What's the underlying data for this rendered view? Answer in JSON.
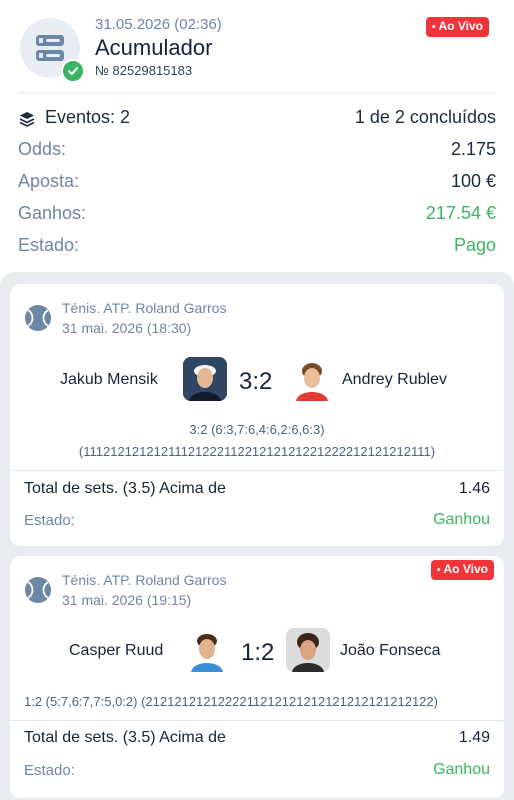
{
  "header": {
    "date": "31.05.2026 (02:36)",
    "title": "Acumulador",
    "number": "№ 82529815183",
    "live_label": "Ao Vivo"
  },
  "summary": {
    "events_label": "Eventos: 2",
    "events_value": "1 de 2 concluídos",
    "odds_label": "Odds:",
    "odds_value": "2.175",
    "stake_label": "Aposta:",
    "stake_value": "100 €",
    "winnings_label": "Ganhos:",
    "winnings_value": "217.54 €",
    "status_label": "Estado:",
    "status_value": "Pago"
  },
  "events": [
    {
      "league": "Ténis. ATP. Roland Garros",
      "date": "31 mai. 2026 (18:30)",
      "player1": "Jakub Mensik",
      "player2": "Andrey Rublev",
      "score": "3:2",
      "detail_line1": "3:2 (6:3,7:6,4:6,2:6,6:3)",
      "detail_line2": "(1112121212121112122211221212121221222212121212111)",
      "market": "Total de sets. (3.5) Acima de",
      "odds": "1.46",
      "status_label": "Estado:",
      "status_value": "Ganhou"
    },
    {
      "league": "Ténis. ATP. Roland Garros",
      "date": "31 mai. 2026 (19:15)",
      "player1": "Casper Ruud",
      "player2": "João Fonseca",
      "score": "1:2",
      "live_label": "Ao Vivo",
      "detail_line1": "1:2 (5:7,6:7,7:5,0:2) (2121212121222211212121212121212121212122)",
      "market": "Total de sets. (3.5) Acima de",
      "odds": "1.49",
      "status_label": "Estado:",
      "status_value": "Ganhou"
    }
  ],
  "colors": {
    "live": "#f0353a",
    "win": "#3cb563",
    "muted": "#6d86a3"
  }
}
